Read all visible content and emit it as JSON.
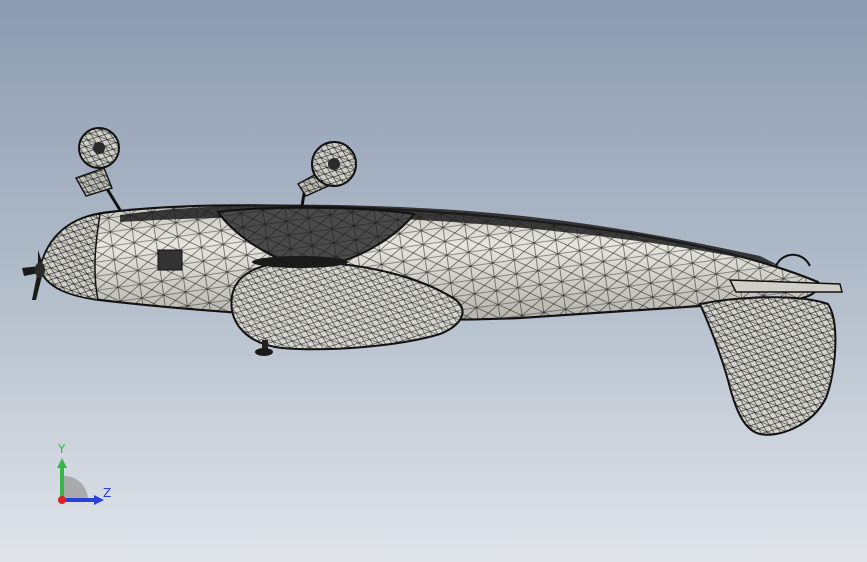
{
  "app": {
    "view": "graphics-area"
  },
  "colors": {
    "background_top": "#8d9cb0",
    "background_bottom": "#dde2e9",
    "model_fill": "#dcdcd6",
    "model_fill_shadow": "#b9b9b2",
    "mesh_line": "#1a1a1a",
    "axis_x": "#e02020",
    "axis_y": "#39b54a",
    "axis_z": "#2a3ed8"
  },
  "triad": {
    "y_label": "Y",
    "z_label": "Z"
  },
  "model": {
    "icon": "wireframe-airplane"
  }
}
